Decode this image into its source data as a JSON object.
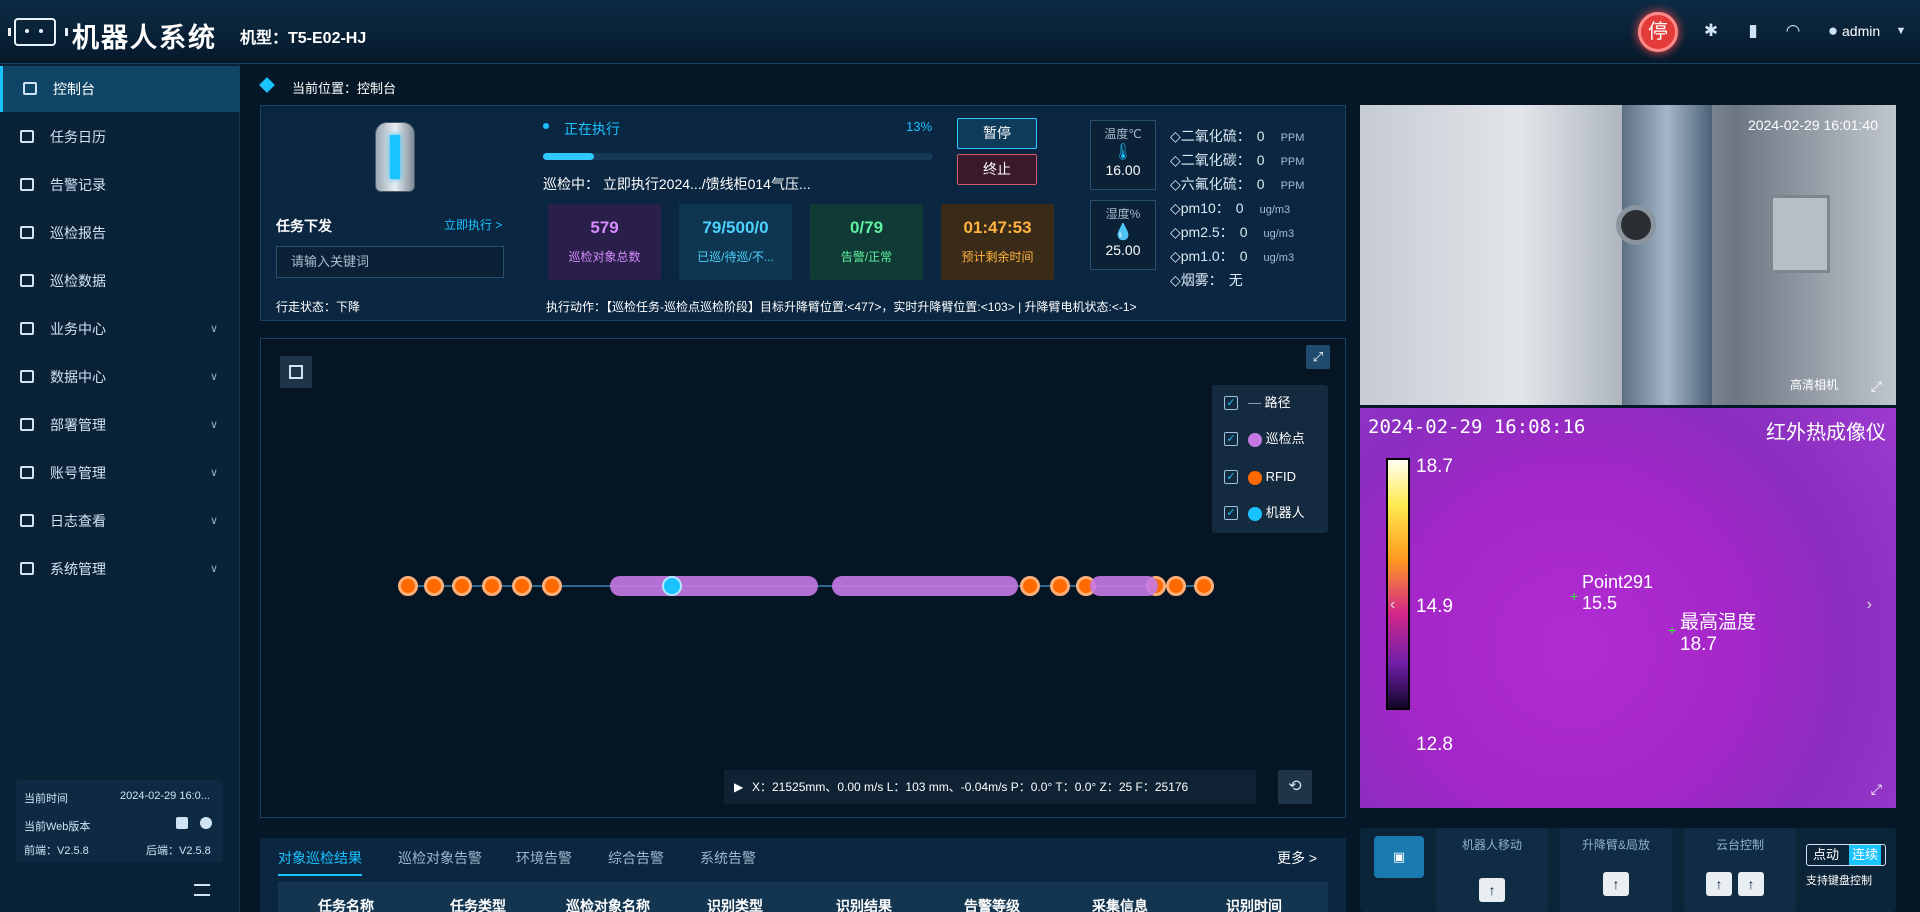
{
  "header": {
    "title": "机器人系统",
    "model": "机型：T5-E02-HJ",
    "stop_label": "停",
    "user": "admin"
  },
  "sidebar": {
    "items": [
      {
        "label": "控制台"
      },
      {
        "label": "任务日历"
      },
      {
        "label": "告警记录"
      },
      {
        "label": "巡检报告"
      },
      {
        "label": "巡检数据"
      },
      {
        "label": "业务中心"
      },
      {
        "label": "数据中心"
      },
      {
        "label": "部署管理"
      },
      {
        "label": "账号管理"
      },
      {
        "label": "日志查看"
      },
      {
        "label": "系统管理"
      }
    ],
    "info": {
      "time_label": "当前时间",
      "time_value": "2024-02-29 16:0...",
      "web_label": "当前Web版本",
      "front": "前端：V2.5.8",
      "back": "后端：V2.5.8"
    }
  },
  "breadcrumb": "当前位置：控制台",
  "task": {
    "title": "任务下发",
    "run_now": "立即执行 >",
    "search_placeholder": "请输入关键词",
    "status": "正在执行",
    "percent": "13%",
    "progress": 0.13,
    "line": "巡检中：  立即执行2024.../馈线柜014气压...",
    "pause": "暂停",
    "stop": "终止",
    "stats": [
      {
        "value": "579",
        "label": "巡检对象总数"
      },
      {
        "value": "79/500/0",
        "label": "已巡/待巡/不..."
      },
      {
        "value": "0/79",
        "label": "告警/正常"
      },
      {
        "value": "01:47:53",
        "label": "预计剩余时间"
      }
    ],
    "walk": "行走状态：下降",
    "action": "执行动作：【巡检任务-巡检点巡检阶段】目标升降臂位置:<477>，实时升降臂位置:<103> | 升降臂电机状态:<-1>"
  },
  "env": {
    "temp_label": "温度℃",
    "temp": "16.00",
    "hum_label": "湿度%",
    "hum": "25.00",
    "gases": [
      {
        "name": "二氧化硫：",
        "value": "0",
        "unit": "PPM"
      },
      {
        "name": "二氧化碳：",
        "value": "0",
        "unit": "PPM"
      },
      {
        "name": "六氟化硫：",
        "value": "0",
        "unit": "PPM"
      },
      {
        "name": "pm10：",
        "value": "0",
        "unit": "ug/m3"
      },
      {
        "name": "pm2.5：",
        "value": "0",
        "unit": "ug/m3"
      },
      {
        "name": "pm1.0：",
        "value": "0",
        "unit": "ug/m3"
      },
      {
        "name": "烟雾：",
        "value": "无",
        "unit": ""
      }
    ]
  },
  "map": {
    "legend": [
      "路径",
      "巡检点",
      "RFID",
      "机器人"
    ],
    "coords": "X：21525mm、0.00 m/s    L：103 mm、-0.04m/s    P：0.0°    T：0.0°    Z：25    F：25176"
  },
  "camera": {
    "timestamp": "2024-02-29 16:01:40",
    "label": "高清相机"
  },
  "ir": {
    "timestamp": "2024-02-29  16:08:16",
    "title": "红外热成像仪",
    "max": "18.7",
    "mid": "14.9",
    "min": "12.8",
    "point_label": "Point291",
    "point_val": "15.5",
    "high_label": "最高温度",
    "high_val": "18.7"
  },
  "tabs": {
    "items": [
      "对象巡检结果",
      "巡检对象告警",
      "环境告警",
      "综合告警",
      "系统告警"
    ],
    "more": "更多 >",
    "columns": [
      "任务名称",
      "任务类型",
      "巡检对象名称",
      "识别类型",
      "识别结果",
      "告警等级",
      "采集信息",
      "识别时间"
    ]
  },
  "controls": {
    "move": "机器人移动",
    "lift": "升降臂&局放",
    "ptz": "云台控制",
    "mode_a": "点动",
    "mode_b": "连续",
    "kbd": "支持键盘控制"
  }
}
